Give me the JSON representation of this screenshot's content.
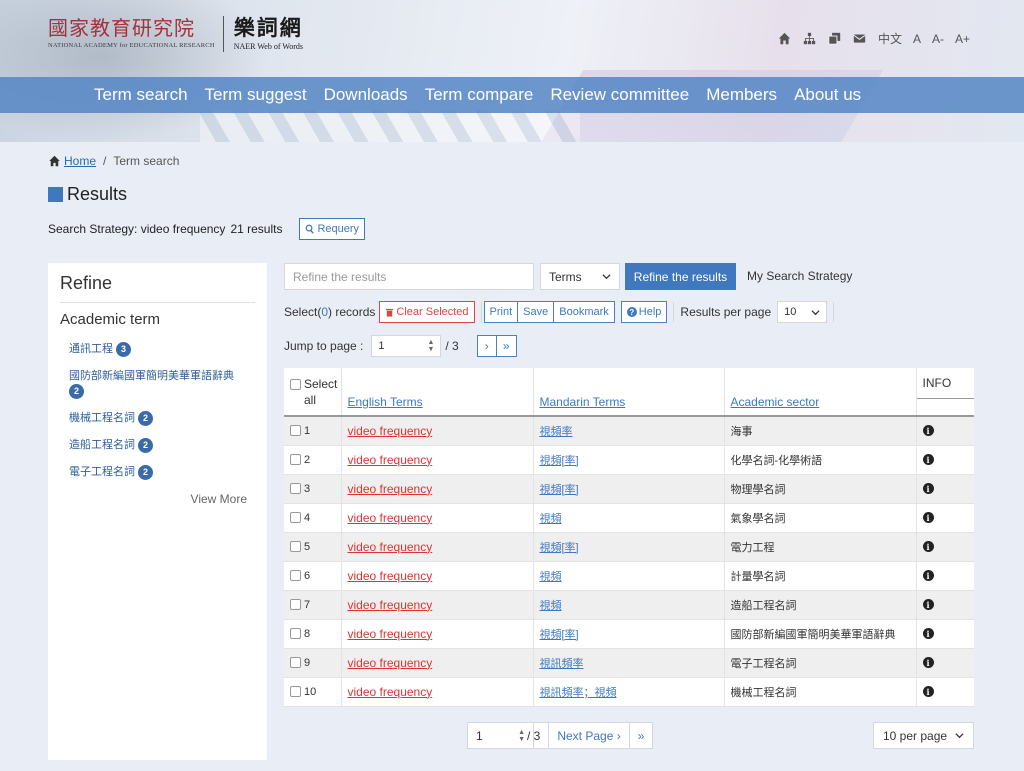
{
  "header": {
    "org_zh": "國家教育研究院",
    "org_en": "NATIONAL ACADEMY for EDUCATIONAL RESEARCH",
    "site_zh": "樂詞網",
    "site_en": "NAER Web of Words",
    "utility": {
      "lang": "中文",
      "font_normal": "A",
      "font_smaller": "A-",
      "font_larger": "A+"
    },
    "nav": [
      "Term search",
      "Term suggest",
      "Downloads",
      "Term compare",
      "Review committee",
      "Members",
      "About us"
    ]
  },
  "breadcrumb": {
    "home": "Home",
    "separator": "/",
    "current": "Term search"
  },
  "results": {
    "title": "Results",
    "strategy_label": "Search Strategy: video frequency",
    "count": "21 results",
    "requery": "Requery"
  },
  "sidebar": {
    "title": "Refine",
    "group_title": "Academic term",
    "facets": [
      {
        "label": "通訊工程",
        "count": "3"
      },
      {
        "label": "國防部新編國軍簡明美華軍語辭典",
        "count": "2"
      },
      {
        "label": "機械工程名詞",
        "count": "2"
      },
      {
        "label": "造船工程名詞",
        "count": "2"
      },
      {
        "label": "電子工程名詞",
        "count": "2"
      }
    ],
    "view_more": "View More"
  },
  "toolbar": {
    "refine_placeholder": "Refine the results",
    "terms_select": "Terms",
    "refine_button": "Refine the results",
    "my_strategy": "My Search Strategy",
    "select_prefix": "Select(",
    "select_count": "0",
    "select_suffix": ") records",
    "clear_selected": "Clear Selected",
    "print": "Print",
    "save": "Save",
    "bookmark": "Bookmark",
    "help": "Help",
    "results_per_page_label": "Results per page",
    "results_per_page": "10",
    "jump_label": "Jump to page :",
    "page_value": "1",
    "page_total": "/ 3",
    "next_icon": "›",
    "last_icon": "»"
  },
  "table": {
    "headers": {
      "select_all": "Select all",
      "english": "English Terms",
      "mandarin": "Mandarin Terms",
      "sector": "Academic sector",
      "info": "INFO"
    },
    "rows": [
      {
        "n": "1",
        "en": "video frequency",
        "zh": "視頻率",
        "sector": "海事"
      },
      {
        "n": "2",
        "en": "video frequency",
        "zh": "視頻[率]",
        "sector": "化學名詞-化學術語"
      },
      {
        "n": "3",
        "en": "video frequency",
        "zh": "視頻[率]",
        "sector": "物理學名詞"
      },
      {
        "n": "4",
        "en": "video frequency",
        "zh": "視頻",
        "sector": "氣象學名詞"
      },
      {
        "n": "5",
        "en": "video frequency",
        "zh": "視頻[率]",
        "sector": "電力工程"
      },
      {
        "n": "6",
        "en": "video frequency",
        "zh": "視頻",
        "sector": "計量學名詞"
      },
      {
        "n": "7",
        "en": "video frequency",
        "zh": "視頻",
        "sector": "造船工程名詞"
      },
      {
        "n": "8",
        "en": "video frequency",
        "zh": "視頻[率]",
        "sector": "國防部新編國軍簡明美華軍語辭典"
      },
      {
        "n": "9",
        "en": "video frequency",
        "zh": "視訊頻率",
        "sector": "電子工程名詞"
      },
      {
        "n": "10",
        "en": "video frequency",
        "zh": "視訊頻率；視頻",
        "sector": "機械工程名詞"
      }
    ]
  },
  "pagination": {
    "page_value": "1",
    "page_total": "/ 3",
    "next_page": "Next Page ›",
    "last": "»",
    "per_page": "10 per page"
  },
  "colors": {
    "accent": "#3f78bf",
    "nav_bar": "#5586c4",
    "danger": "#dd3333",
    "brand_red": "#a3313a"
  },
  "icons": [
    "home-icon",
    "sitemap-icon",
    "copy-icon",
    "mail-icon",
    "search-icon",
    "trash-icon",
    "help-icon",
    "info-icon",
    "chevron-down-icon"
  ]
}
